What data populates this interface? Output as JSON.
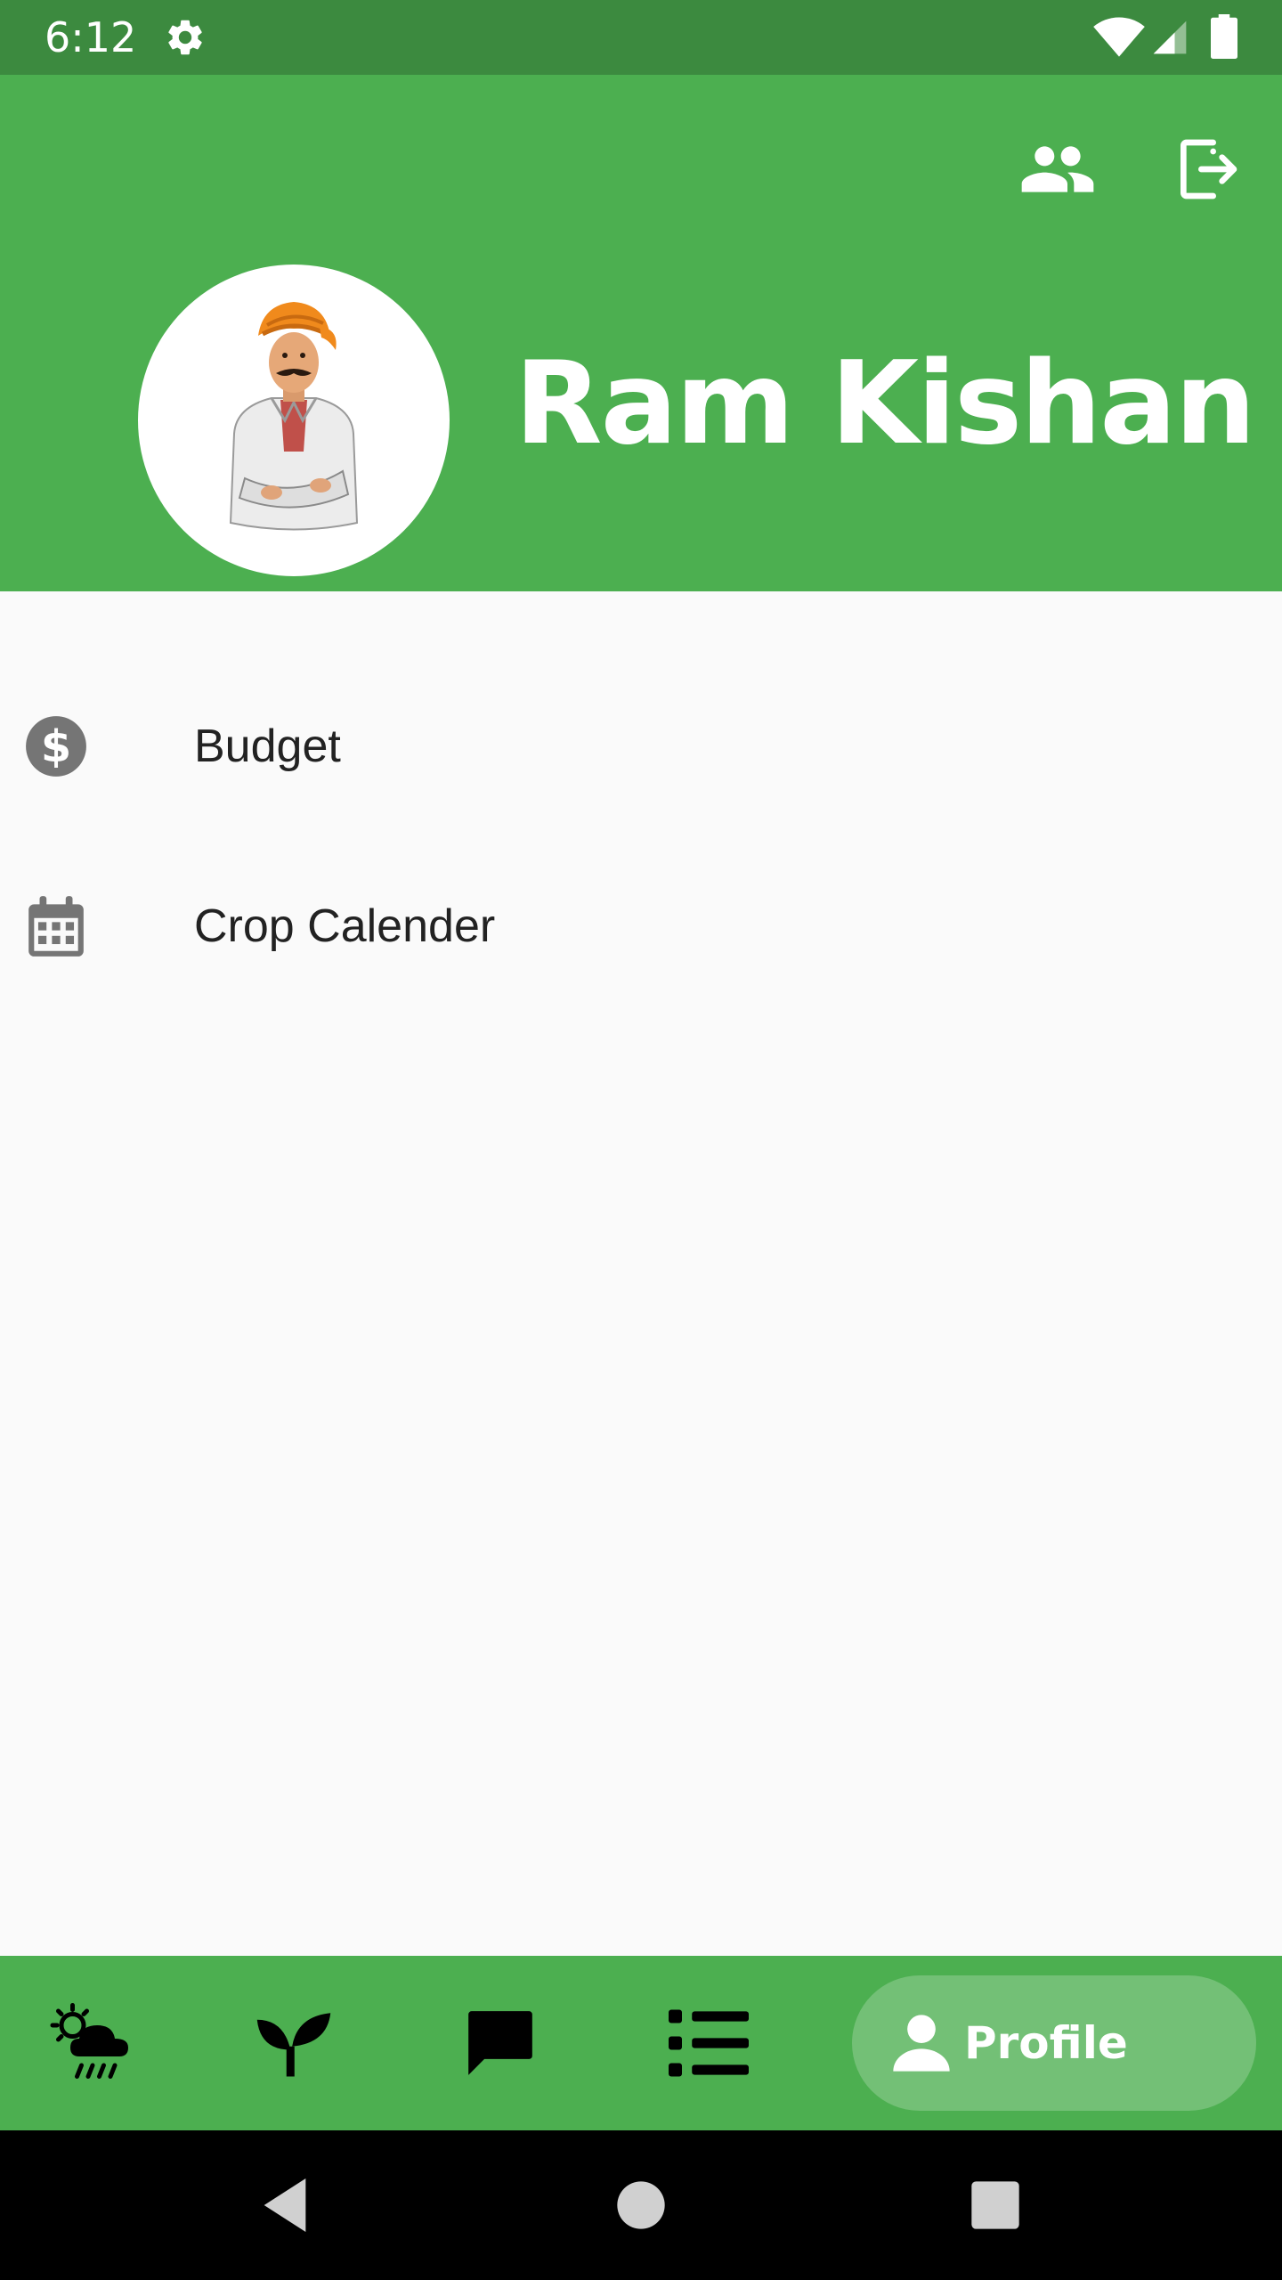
{
  "status_bar": {
    "time": "6:12"
  },
  "header": {
    "name": "Ram Kishan",
    "bg_color": "#4caf50"
  },
  "menu": {
    "items": [
      {
        "label": "Budget",
        "icon": "dollar-circle-icon"
      },
      {
        "label": "Crop Calender",
        "icon": "calendar-icon"
      }
    ]
  },
  "bottom_nav": {
    "items": [
      {
        "icon": "weather-icon"
      },
      {
        "icon": "sprout-icon"
      },
      {
        "icon": "chat-icon"
      },
      {
        "icon": "list-icon"
      }
    ],
    "active": {
      "label": "Profile",
      "icon": "person-icon"
    }
  },
  "colors": {
    "primary": "#4caf50",
    "status_bar": "#3c8a3f",
    "background": "#fafafa"
  }
}
